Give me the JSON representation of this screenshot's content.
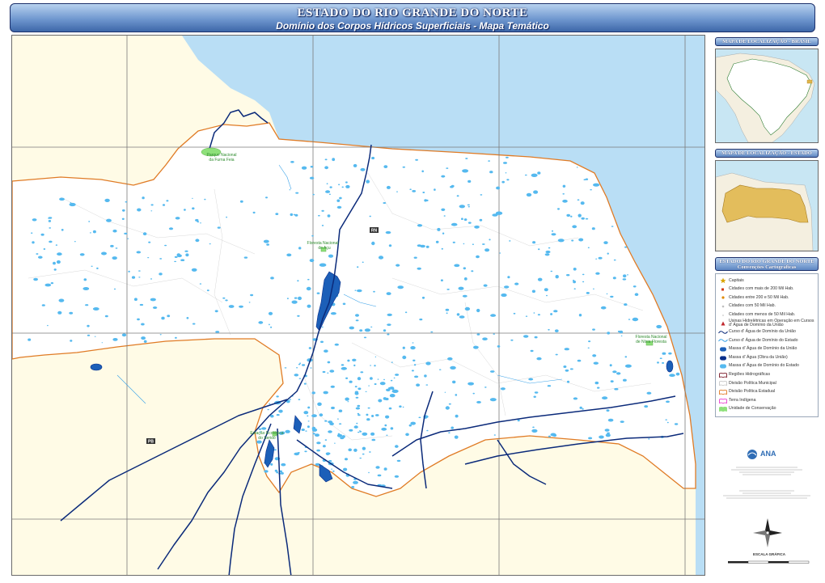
{
  "header": {
    "title": "ESTADO DO RIO GRANDE DO NORTE",
    "subtitle": "Domínio dos Corpos Hídricos Superficiais - Mapa Temático"
  },
  "map_labels": {
    "rn": "RN",
    "pb": "PB",
    "parque_furna_feia_1": "Parque Nacional",
    "parque_furna_feia_2": "da Furna Feia",
    "flona_acu_1": "Floresta Nacional",
    "flona_acu_2": "do Açu",
    "flona_nisia_1": "Floresta Nacional",
    "flona_nisia_2": "de Nísia Floresta",
    "esec_serido_1": "Estação Ecológica",
    "esec_serido_2": "do Seridó"
  },
  "inset_brasil": {
    "header": "MAPA DE LOCALIZAÇÃO - BRASIL"
  },
  "inset_estado": {
    "header": "MAPA DE LOCALIZAÇÃO - ESTADO"
  },
  "legend": {
    "header_1": "ESTADO DO RIO GRANDE DO NORTE",
    "header_2": "Convenções Cartográficas",
    "items": [
      {
        "label": "Capitais",
        "symbol": "star",
        "color": "#d9a400"
      },
      {
        "label": "Cidades com mais de 200 Mil Hab.",
        "symbol": "square",
        "color": "#d23b1a"
      },
      {
        "label": "Cidades entre 200 e 50 Mil Hab.",
        "symbol": "dot",
        "color": "#e08a00"
      },
      {
        "label": "Cidades com 50 Mil Hab.",
        "symbol": "dot-small",
        "color": "#bdbdbd"
      },
      {
        "label": "Cidades com menos de 50 Mil Hab.",
        "symbol": "dot-tiny",
        "color": "#d6d6d6"
      },
      {
        "label": "Usinas Hidrelétricas em Operação em Cursos d' Água de Domínio da União",
        "symbol": "triangle",
        "color": "#c0272d"
      },
      {
        "label": "Curso d' Água de Domínio da União",
        "symbol": "wave",
        "color": "#0b2a7a"
      },
      {
        "label": "Curso d' Água de Domínio do Estado",
        "symbol": "wave",
        "color": "#3aa2e8"
      },
      {
        "label": "Massa d' Água de Domínio da União",
        "symbol": "blob",
        "color": "#1c5fb8"
      },
      {
        "label": "Massa d' Água (Obra da União)",
        "symbol": "blob",
        "color": "#0a2f8a"
      },
      {
        "label": "Massa d' Água de Domínio do Estado",
        "symbol": "blob",
        "color": "#55b9ef"
      },
      {
        "label": "Regiões Hidrográficas",
        "symbol": "region",
        "color": "#7a1a2a"
      },
      {
        "label": "Divisão Política Municipal",
        "symbol": "region",
        "color": "#c8c8c8"
      },
      {
        "label": "Divisão Política Estadual",
        "symbol": "region",
        "color": "#e07b25"
      },
      {
        "label": "Terra Indígena",
        "symbol": "region",
        "color": "#e83fd0"
      },
      {
        "label": "Unidade de Conservação",
        "symbol": "region-fill",
        "color": "#8ee07a"
      }
    ]
  },
  "logo": {
    "name": "ANA"
  },
  "scale": {
    "label": "ESCALA GRÁFICA"
  },
  "colors": {
    "ocean": "#b9def5",
    "state_fill": "#ffffff",
    "neighbor_fill": "#fff9e3",
    "state_border": "#e07b25",
    "river_union": "#0b2a7a",
    "water_state": "#55b9ef",
    "water_union": "#1c5fb8",
    "grid": "#7a7a7a",
    "conservation": "#8ee07a"
  }
}
